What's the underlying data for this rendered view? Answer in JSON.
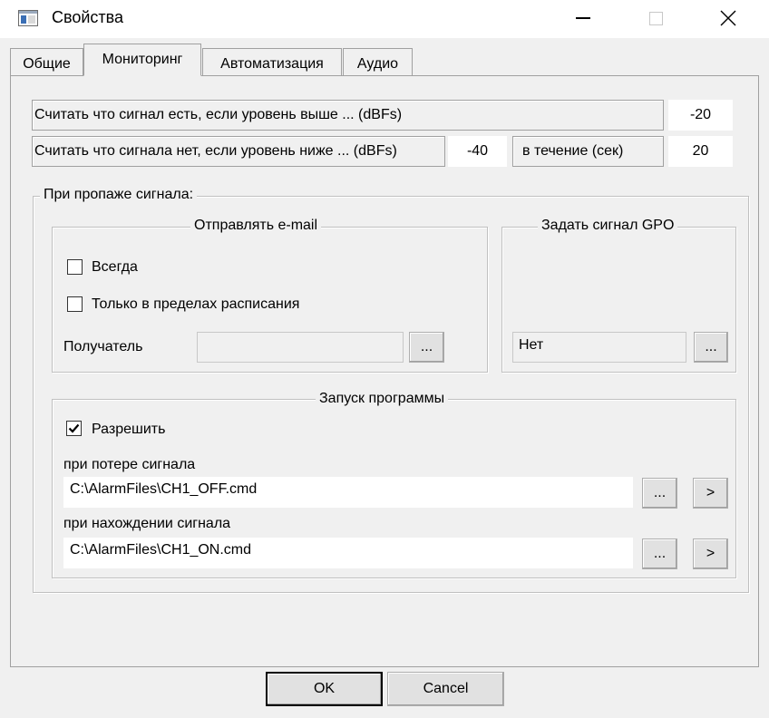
{
  "window": {
    "title": "Свойства",
    "minimize_glyph": "—",
    "maximize_glyph": "☐",
    "close_glyph": "✕"
  },
  "tabs": [
    {
      "label": "Общие",
      "active": false
    },
    {
      "label": "Мониторинг",
      "active": true
    },
    {
      "label": "Автоматизация",
      "active": false
    },
    {
      "label": "Аудио",
      "active": false
    }
  ],
  "thresholds": {
    "signal_present_label": "Считать что сигнал есть, если уровень выше ... (dBFs)",
    "signal_present_value": "-20",
    "signal_absent_label": "Считать что сигнала нет, если уровень ниже ... (dBFs)",
    "signal_absent_value": "-40",
    "duration_label": "в течение (сек)",
    "duration_value": "20"
  },
  "signal_loss": {
    "title": "При пропаже сигнала:",
    "email": {
      "title": "Отправлять e-mail",
      "always_label": "Всегда",
      "always_checked": false,
      "schedule_label": "Только в пределах расписания",
      "schedule_checked": false,
      "recipient_label": "Получатель",
      "recipient_value": "",
      "browse_label": "..."
    },
    "gpo": {
      "title": "Задать сигнал GPO",
      "value": "Нет",
      "browse_label": "..."
    },
    "program": {
      "title": "Запуск программы",
      "enable_label": "Разрешить",
      "enable_checked": true,
      "on_loss_label": "при потере сигнала",
      "on_loss_path": "C:\\AlarmFiles\\CH1_OFF.cmd",
      "on_found_label": "при нахождении сигнала",
      "on_found_path": "C:\\AlarmFiles\\CH1_ON.cmd",
      "browse_label": "...",
      "run_label": ">"
    }
  },
  "footer": {
    "ok_label": "OK",
    "cancel_label": "Cancel"
  }
}
